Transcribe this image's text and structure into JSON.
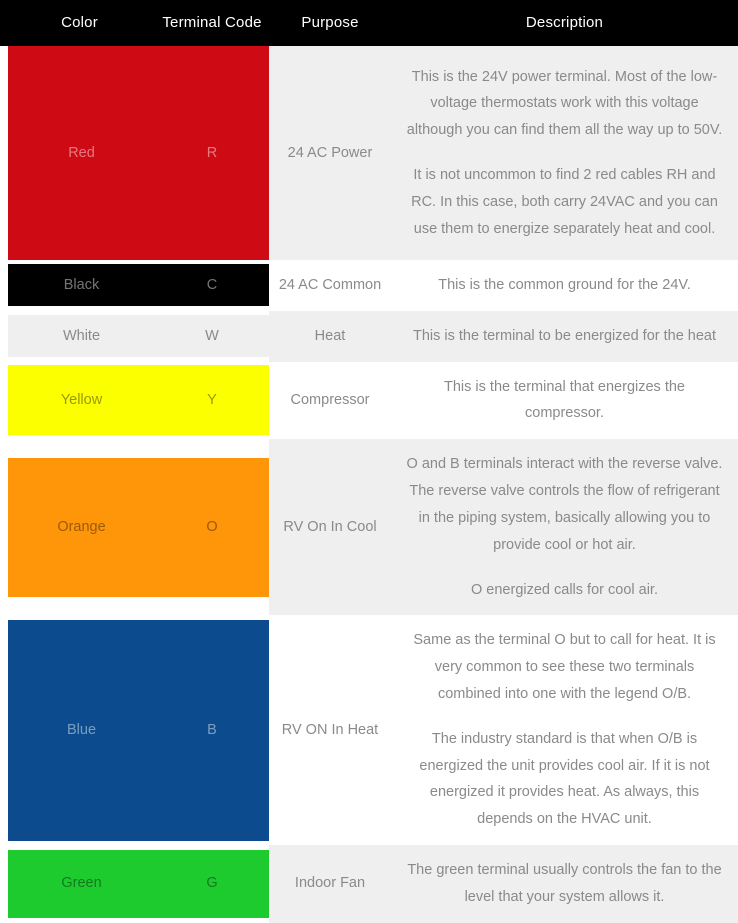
{
  "table": {
    "headers": {
      "color": "Color",
      "terminal_code": "Terminal Code",
      "purpose": "Purpose",
      "description": "Description"
    },
    "header_background": "#000000",
    "header_text_color": "#ffffff",
    "body_text_color": "#8a8a8a",
    "stripe_color": "#efefef",
    "rows": [
      {
        "color_name": "Red",
        "swatch_hex": "#ce0a15",
        "terminal_code": "R",
        "purpose": "24 AC Power",
        "description_paragraphs": [
          "This is the 24V power terminal. Most of the low-voltage thermostats work with this voltage although you can find them all the way up to 50V.",
          "It is not uncommon to find 2 red cables RH and RC. In this case, both carry 24VAC and you can use them to energize separately heat and cool."
        ]
      },
      {
        "color_name": "Black",
        "swatch_hex": "#000000",
        "terminal_code": "C",
        "purpose": "24 AC Common",
        "description_paragraphs": [
          "This is the common ground for the 24V."
        ]
      },
      {
        "color_name": "White",
        "swatch_hex": "#efefef",
        "terminal_code": "W",
        "purpose": "Heat",
        "description_paragraphs": [
          "This is the terminal to be energized for the heat"
        ]
      },
      {
        "color_name": "Yellow",
        "swatch_hex": "#fbff00",
        "terminal_code": "Y",
        "purpose": "Compressor",
        "description_paragraphs": [
          "This is the terminal that energizes the compressor."
        ]
      },
      {
        "color_name": "Orange",
        "swatch_hex": "#ff960a",
        "terminal_code": "O",
        "purpose": "RV On In Cool",
        "description_paragraphs": [
          "O and B terminals interact with the reverse valve. The reverse valve controls the flow of refrigerant in the piping system, basically allowing you to provide cool or hot air.",
          "O energized calls for cool air."
        ]
      },
      {
        "color_name": "Blue",
        "swatch_hex": "#0c4b8e",
        "terminal_code": "B",
        "purpose": "RV ON In Heat",
        "description_paragraphs": [
          "Same as the terminal O but to call for heat. It is very common to see these two terminals combined into one with the legend O/B.",
          "The industry standard is that when O/B is energized the unit provides cool air. If it is not energized it provides heat. As always, this depends on the HVAC unit."
        ]
      },
      {
        "color_name": "Green",
        "swatch_hex": "#1ecb2e",
        "terminal_code": "G",
        "purpose": "Indoor Fan",
        "description_paragraphs": [
          "The green terminal usually controls the fan to the level that your system allows it."
        ]
      }
    ]
  }
}
